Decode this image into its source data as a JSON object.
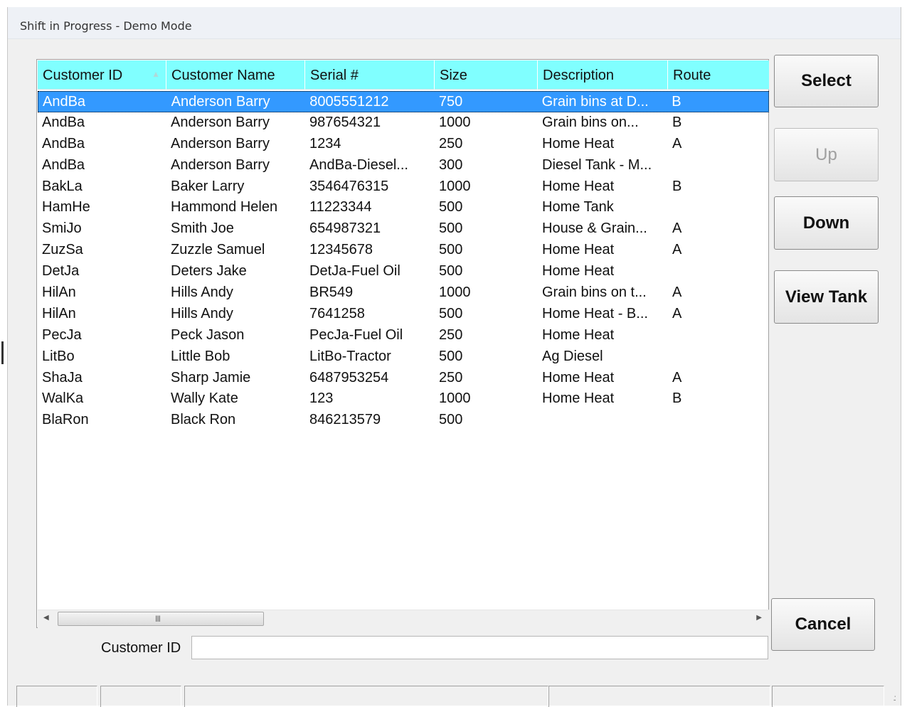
{
  "window": {
    "title": "Shift in Progress - Demo Mode"
  },
  "table": {
    "columns": [
      "Customer ID",
      "Customer Name",
      "Serial #",
      "Size",
      "Description",
      "Route"
    ],
    "rows": [
      [
        "AndBa",
        "Anderson Barry",
        "8005551212",
        "750",
        "Grain bins at D...",
        "B"
      ],
      [
        "AndBa",
        "Anderson Barry",
        "987654321",
        "1000",
        "Grain bins on...",
        "B"
      ],
      [
        "AndBa",
        "Anderson Barry",
        "1234",
        "250",
        "Home Heat",
        "A"
      ],
      [
        "AndBa",
        "Anderson Barry",
        "AndBa-Diesel...",
        "300",
        "Diesel Tank - M...",
        ""
      ],
      [
        "BakLa",
        "Baker Larry",
        "3546476315",
        "1000",
        "Home Heat",
        "B"
      ],
      [
        "HamHe",
        "Hammond Helen",
        "11223344",
        "500",
        "Home Tank",
        ""
      ],
      [
        "SmiJo",
        "Smith Joe",
        "654987321",
        "500",
        "House & Grain...",
        "A"
      ],
      [
        "ZuzSa",
        "Zuzzle Samuel",
        "12345678",
        "500",
        "Home Heat",
        "A"
      ],
      [
        "DetJa",
        "Deters Jake",
        "DetJa-Fuel Oil",
        "500",
        "Home Heat",
        ""
      ],
      [
        "HilAn",
        "Hills Andy",
        "BR549",
        "1000",
        "Grain bins on t...",
        "A"
      ],
      [
        "HilAn",
        "Hills Andy",
        "7641258",
        "500",
        "Home Heat - B...",
        "A"
      ],
      [
        "PecJa",
        "Peck Jason",
        "PecJa-Fuel Oil",
        "250",
        "Home Heat",
        ""
      ],
      [
        "LitBo",
        "Little Bob",
        "LitBo-Tractor",
        "500",
        "Ag Diesel",
        ""
      ],
      [
        "ShaJa",
        "Sharp Jamie",
        "6487953254",
        "250",
        "Home Heat",
        "A"
      ],
      [
        "WalKa",
        "Wally Kate",
        "123",
        "1000",
        "Home Heat",
        "B"
      ],
      [
        "BlaRon",
        "Black Ron",
        "846213579",
        "500",
        "",
        ""
      ]
    ],
    "selected_row": 0,
    "scrollbar_grip": "III"
  },
  "buttons": {
    "select": "Select",
    "up": "Up",
    "down": "Down",
    "view_tank": "View Tank",
    "cancel": "Cancel"
  },
  "customer_id": {
    "label": "Customer ID",
    "value": ""
  },
  "colors": {
    "header_bg": "#80ffff",
    "selection": "#3399ff"
  }
}
